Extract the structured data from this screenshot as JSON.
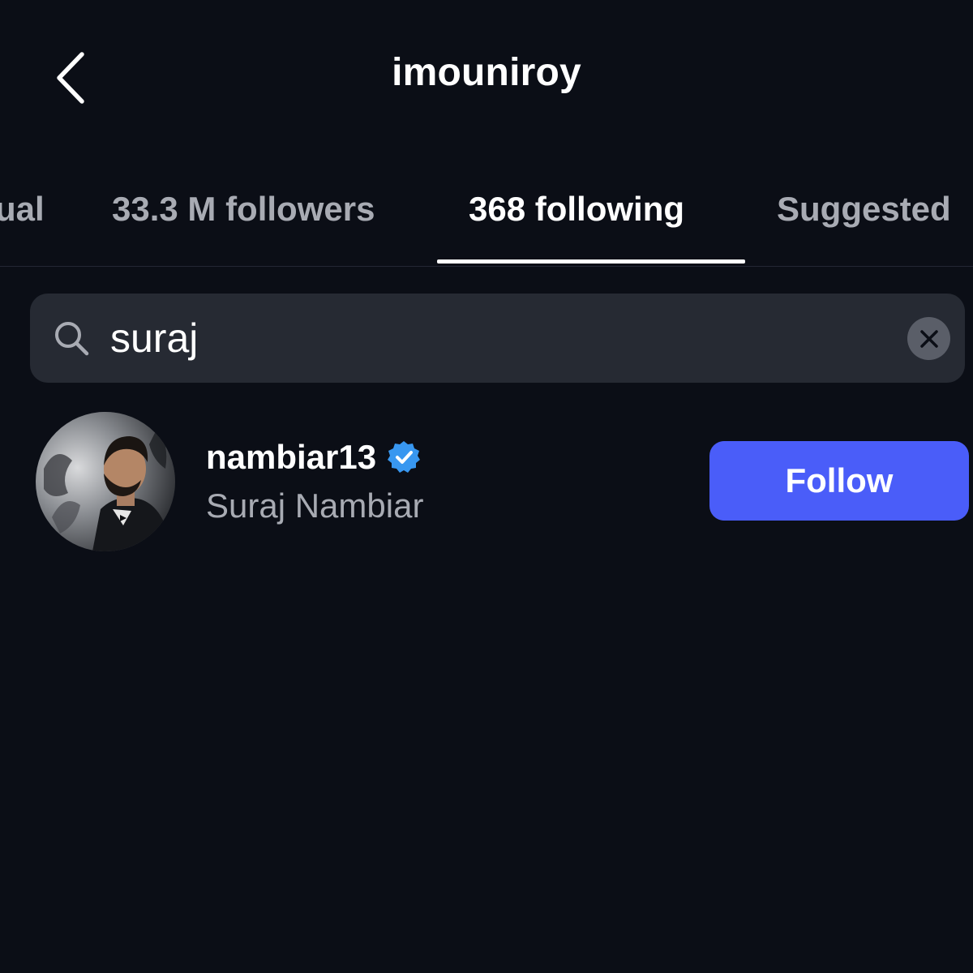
{
  "header": {
    "title": "imouniroy",
    "back_icon": "chevron-left-icon"
  },
  "tabs": [
    {
      "label": "ual",
      "active": false
    },
    {
      "label": "33.3 M followers",
      "active": false
    },
    {
      "label": "368 following",
      "active": true
    },
    {
      "label": "Suggested",
      "active": false
    }
  ],
  "search": {
    "value": "suraj",
    "icon": "search-icon",
    "clear_icon": "close-icon"
  },
  "results": [
    {
      "username": "nambiar13",
      "verified": true,
      "full_name": "Suraj Nambiar",
      "action_label": "Follow"
    }
  ],
  "colors": {
    "background": "#0b0e16",
    "search_bg": "#262a33",
    "follow_button": "#4a5df9",
    "verified_badge": "#3897f0",
    "secondary_text": "#a8abb3"
  }
}
